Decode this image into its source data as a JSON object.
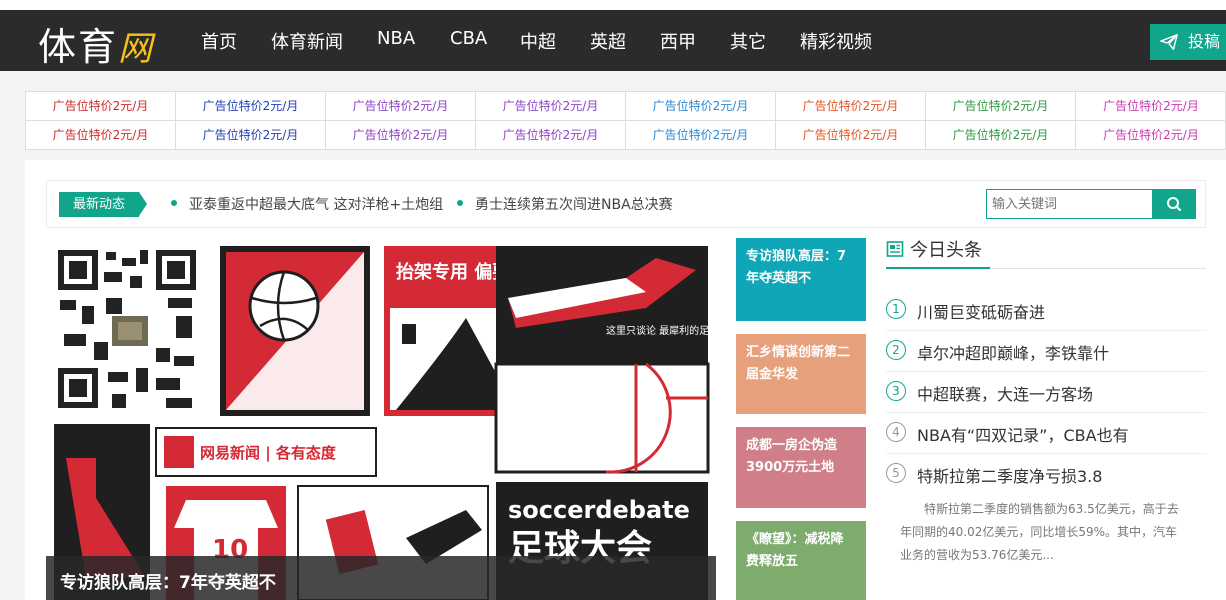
{
  "logo": {
    "main": "体育",
    "accent": "网"
  },
  "nav": {
    "items": [
      "首页",
      "体育新闻",
      "NBA",
      "CBA",
      "中超",
      "英超",
      "西甲",
      "其它",
      "精彩视频"
    ],
    "submit_label": "投稿"
  },
  "ads": {
    "label": "广告位特价2元/月",
    "colors": [
      "#cc2b2b",
      "#1e3fb0",
      "#8f3fc8",
      "#8f3fc8",
      "#2a88d6",
      "#e2541d",
      "#2a9a3e",
      "#c83ab0"
    ]
  },
  "news": {
    "tag": "最新动态",
    "items": [
      "亚泰重返中超最大底气 这对洋枪+土炮组",
      "勇士连续第五次闯进NBA总决赛"
    ],
    "search_placeholder": "输入关键词"
  },
  "poster": {
    "caption": "专访狼队高层：7年夺英超不",
    "texts": {
      "banner": "抬架专用 偏要较真",
      "quote": "这里只谈论 最犀利的足球观点",
      "badge": "网易新闻 | 各有态度",
      "number": "10",
      "en_title": "soccerdebate",
      "cn_title": "足球大会"
    }
  },
  "tiles": [
    {
      "text": "专访狼队高层：7年夺英超不",
      "color": "#0fa7b7"
    },
    {
      "text": "汇乡情谋创新第二届金华发",
      "color": "#e7a07c"
    },
    {
      "text": "成都一房企伪造3900万元土地",
      "color": "#d07f89"
    },
    {
      "text": "《瞭望》：减税降费释放五",
      "color": "#7eac6d"
    }
  ],
  "toutiao": {
    "title": "今日头条",
    "items": [
      {
        "num": "1",
        "text": "川蜀巨变砥砺奋进"
      },
      {
        "num": "2",
        "text": "卓尔冲超即巅峰，李铁靠什"
      },
      {
        "num": "3",
        "text": "中超联赛，大连一方客场"
      },
      {
        "num": "4",
        "text": "NBA有“四双记录”，CBA也有"
      },
      {
        "num": "5",
        "text": "特斯拉第二季度净亏损3.8"
      }
    ],
    "summary": "特斯拉第二季度的销售额为63.5亿美元，高于去年同期的40.02亿美元，同比增长59%。其中，汽车业务的营收为53.76亿美元..."
  }
}
